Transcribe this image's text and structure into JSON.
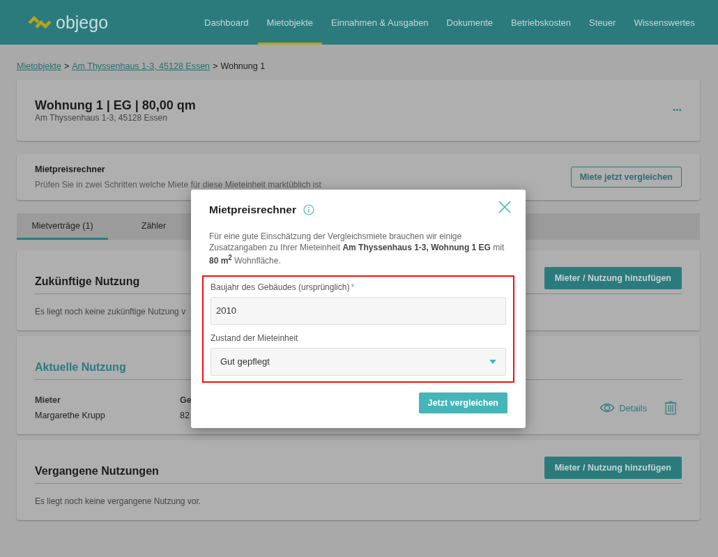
{
  "header": {
    "logo": "objego",
    "nav": [
      {
        "label": "Dashboard",
        "selected": false
      },
      {
        "label": "Mietobjekte",
        "selected": true
      },
      {
        "label": "Einnahmen & Ausgaben",
        "selected": false
      },
      {
        "label": "Dokumente",
        "selected": false
      },
      {
        "label": "Betriebskosten",
        "selected": false
      },
      {
        "label": "Steuer",
        "selected": false
      },
      {
        "label": "Wissenswertes",
        "selected": false
      }
    ]
  },
  "breadcrumb": {
    "links": [
      "Mietobjekte",
      "Am Thyssenhaus 1-3, 45128 Essen"
    ],
    "separator": ">",
    "current": "Wohnung 1"
  },
  "unit": {
    "title": "Wohnung 1 | EG | 80,00 qm",
    "address": "Am Thyssenhaus 1-3, 45128 Essen",
    "menu": "..."
  },
  "calculator_card": {
    "title": "Mietpreisrechner",
    "text": "Prüfen Sie in zwei Schritten welche Miete für diese Mieteinheit marktüblich ist",
    "button": "Miete jetzt vergleichen"
  },
  "tabs": [
    {
      "label": "Mietverträge (1)",
      "selected": true
    },
    {
      "label": "Zähler",
      "selected": false
    }
  ],
  "sections": [
    {
      "kind": "empty",
      "title": "Zukünftige Nutzung",
      "accent": false,
      "button": "Mieter / Nutzung hinzufügen",
      "text": "Es liegt noch keine zukünftige Nutzung v"
    },
    {
      "kind": "table",
      "title": "Aktuelle Nutzung",
      "accent": true,
      "columns": [
        "Mieter",
        "Ge"
      ],
      "row": [
        "Margarethe Krupp",
        "82"
      ],
      "details": "Details"
    },
    {
      "kind": "empty",
      "title": "Vergangene Nutzungen",
      "accent": false,
      "button": "Mieter / Nutzung hinzufügen",
      "text": "Es liegt noch keine vergangene Nutzung vor."
    }
  ],
  "modal": {
    "title": "Mietpreisrechner",
    "intro": "Für eine gute Einschätzung der Vergleichsmiete brauchen wir einige Zusatzangaben zu Ihrer Mieteinheit **Am Thyssenhaus 1-3, Wohnung 1 EG** mit **80 m$^{2}$** Wohnfläche.",
    "fields": [
      {
        "kind": "text",
        "label": "Baujahr des Gebäudes (ursprünglich)",
        "required": true,
        "value": "2010"
      },
      {
        "kind": "select",
        "label": "Zustand der Mieteinheit",
        "required": false,
        "value": "Gut gepflegt"
      }
    ],
    "required_mark": "*",
    "highlighted": true,
    "button": "Jetzt vergleichen"
  }
}
